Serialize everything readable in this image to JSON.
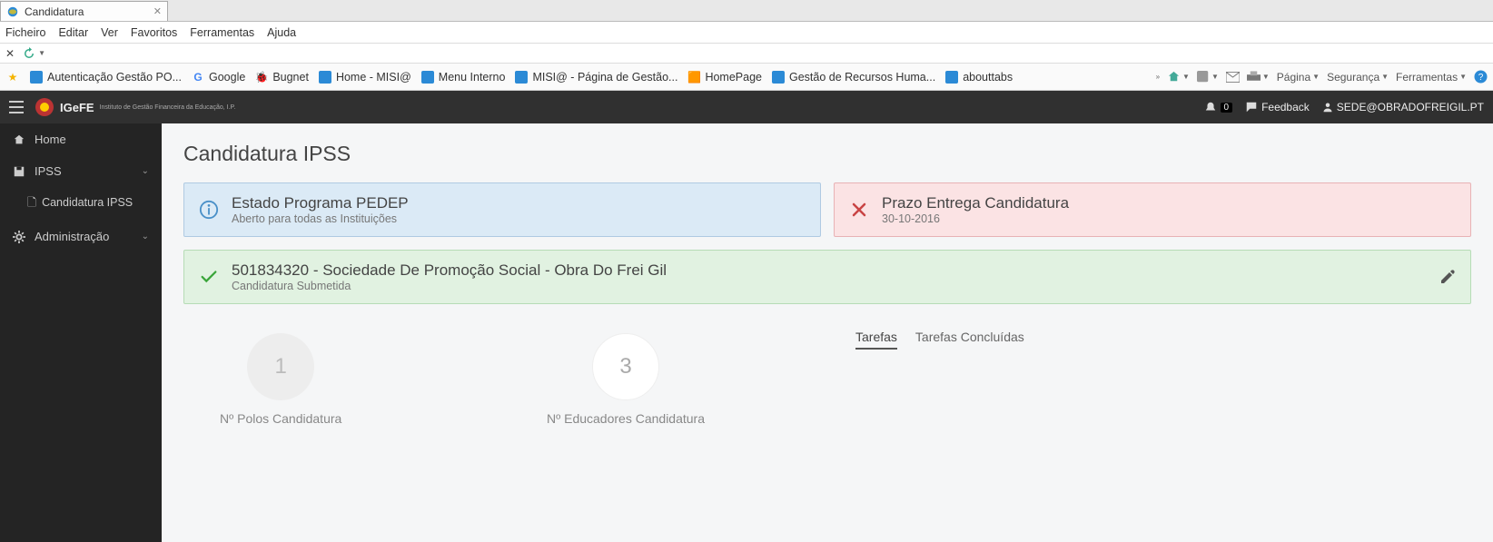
{
  "browser": {
    "tab_title": "Candidatura",
    "menu": [
      "Ficheiro",
      "Editar",
      "Ver",
      "Favoritos",
      "Ferramentas",
      "Ajuda"
    ],
    "favorites": [
      {
        "icon": "ie",
        "label": "Autenticação  Gestão PO..."
      },
      {
        "icon": "g",
        "label": "Google"
      },
      {
        "icon": "bug",
        "label": "Bugnet"
      },
      {
        "icon": "ie",
        "label": "Home - MISI@"
      },
      {
        "icon": "ie",
        "label": "Menu Interno"
      },
      {
        "icon": "ie",
        "label": "MISI@ - Página de Gestão..."
      },
      {
        "icon": "hp",
        "label": "HomePage"
      },
      {
        "icon": "ie",
        "label": "Gestão de Recursos Huma..."
      },
      {
        "icon": "ie",
        "label": "abouttabs"
      }
    ],
    "right_menus": [
      "Página",
      "Segurança",
      "Ferramentas"
    ]
  },
  "topbar": {
    "brand_main": "IGeFE",
    "brand_sub": "Instituto de Gestão Financeira da Educação, I.P.",
    "notif_count": "0",
    "feedback": "Feedback",
    "user": "SEDE@OBRADOFREIGIL.PT"
  },
  "sidebar": {
    "home": "Home",
    "ipss": "IPSS",
    "ipss_sub": "Candidatura IPSS",
    "admin": "Administração"
  },
  "page": {
    "title": "Candidatura IPSS",
    "estado": {
      "title": "Estado Programa PEDEP",
      "sub": "Aberto para todas as Instituições"
    },
    "prazo": {
      "title": "Prazo Entrega Candidatura",
      "sub": "30-10-2016"
    },
    "inst": {
      "title": "501834320 - Sociedade De Promoção Social - Obra Do Frei Gil",
      "sub": "Candidatura Submetida"
    },
    "stat1": {
      "value": "1",
      "label": "Nº Polos Candidatura"
    },
    "stat2": {
      "value": "3",
      "label": "Nº Educadores Candidatura"
    },
    "tabs": {
      "t1": "Tarefas",
      "t2": "Tarefas Concluídas"
    }
  }
}
